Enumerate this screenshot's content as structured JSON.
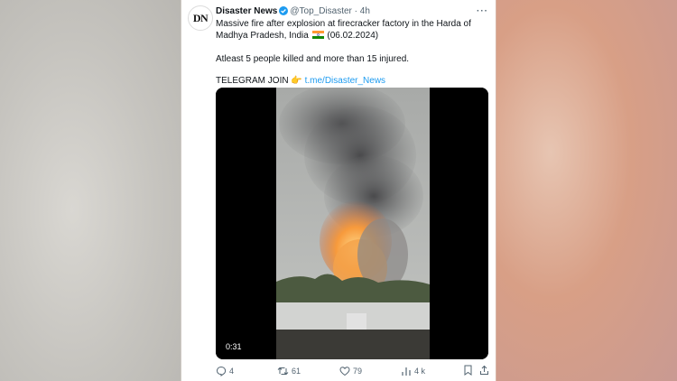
{
  "tweet": {
    "display_name": "Disaster News",
    "handle": "@Top_Disaster",
    "time": "4h",
    "avatar_text": "DN",
    "more_label": "···",
    "text_line1": "Massive fire after explosion at firecracker factory in the Harda of Madhya Pradesh, India",
    "text_date": "(06.02.2024)",
    "text_line2": "Atleast 5 people killed and more than 15 injured.",
    "telegram_label": "TELEGRAM JOIN",
    "telegram_emoji": "👉",
    "telegram_link": "t.me/Disaster_News",
    "video_duration": "0:31",
    "reply_count": "4",
    "retweet_count": "61",
    "like_count": "79",
    "view_count": "4 k"
  },
  "colors": {
    "accent": "#1d9bf0",
    "text": "#0f1419",
    "muted": "#536471"
  },
  "icons": [
    "verified-badge-icon",
    "india-flag-icon",
    "pointing-hand-icon",
    "reply-icon",
    "retweet-icon",
    "like-icon",
    "views-icon",
    "bookmark-icon",
    "share-icon"
  ]
}
